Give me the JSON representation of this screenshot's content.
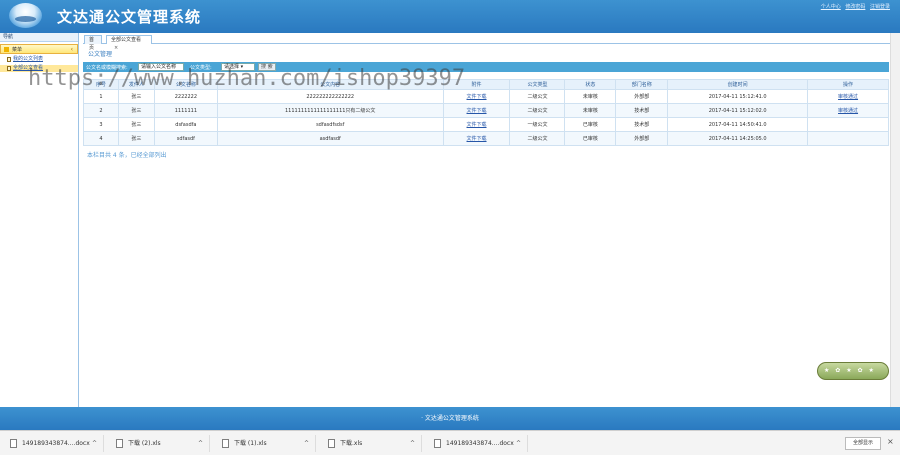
{
  "header": {
    "title": "文达通公文管理系统",
    "links": [
      "个人中心",
      "修改密码",
      "注销登录"
    ]
  },
  "sidebar": {
    "title": "导航",
    "group": "菜单",
    "items": [
      {
        "label": "我的公文列表"
      },
      {
        "label": "全部公文查看"
      }
    ]
  },
  "tabs": [
    {
      "label": "首页"
    },
    {
      "label": "全部公文查看"
    }
  ],
  "panel": {
    "title": "公文管理",
    "search_label": "公文名或模糊搜索:",
    "search_value": "请输入公文名称",
    "type_label": "公文类型:",
    "type_value": "请选择",
    "search_button": "搜 索"
  },
  "table": {
    "headers": [
      "序号",
      "发件人",
      "公文名称",
      "公文内容",
      "附件",
      "公文类型",
      "状态",
      "部门名称",
      "创建时间",
      "操作"
    ],
    "rows": [
      {
        "no": "1",
        "sender": "张三",
        "name": "2222222",
        "content": "222222222222222",
        "attach": "文件下载",
        "type": "二级公文",
        "status": "未审核",
        "dept": "外部部",
        "time": "2017-04-11 15:12:41.0",
        "action": "审核通过"
      },
      {
        "no": "2",
        "sender": "张三",
        "name": "1111111",
        "content": "1111111111111111111只有二级公文",
        "attach": "文件下载",
        "type": "二级公文",
        "status": "未审核",
        "dept": "技术部",
        "time": "2017-04-11 15:12:02.0",
        "action": "审核通过"
      },
      {
        "no": "3",
        "sender": "张三",
        "name": "dsfasdfa",
        "content": "sdfasdfsdsf",
        "attach": "文件下载",
        "type": "一级公文",
        "status": "已审核",
        "dept": "技术部",
        "time": "2017-04-11 14:50:41.0",
        "action": ""
      },
      {
        "no": "4",
        "sender": "张三",
        "name": "sdfasdf",
        "content": "asdfasdf",
        "attach": "文件下载",
        "type": "二级公文",
        "status": "已审核",
        "dept": "外部部",
        "time": "2017-04-11 14:25:05.0",
        "action": ""
      }
    ]
  },
  "summary": "本栏目共 4 条，已经全部列出",
  "footer": "· 文达通公文管理系统",
  "watermark": "https://www.huzhan.com/ishop39397",
  "downloads": [
    {
      "name": "149189343874....docx"
    },
    {
      "name": "下载 (2).xls"
    },
    {
      "name": "下载 (1).xls"
    },
    {
      "name": "下载.xls"
    },
    {
      "name": "149189343874....docx"
    }
  ],
  "show_all": "全部显示",
  "colors": {
    "header_blue": "#2a79c0",
    "toolbar_blue": "#4aa5d6",
    "link_blue": "#2656a8",
    "menu_yellow": "#ffe77a"
  }
}
